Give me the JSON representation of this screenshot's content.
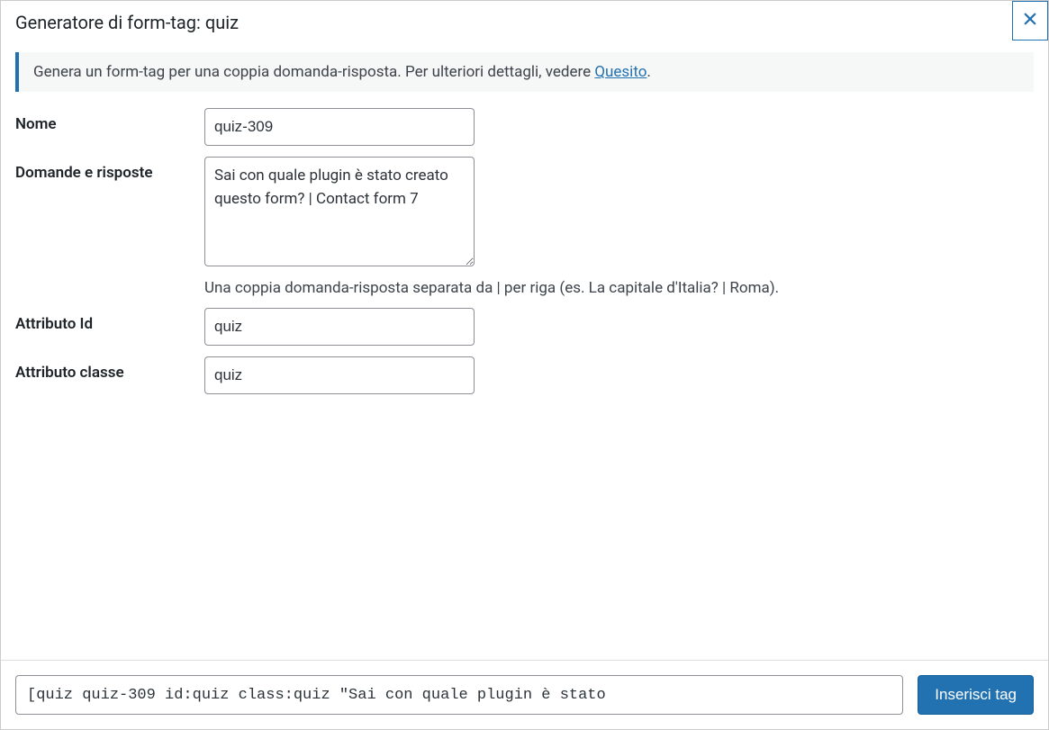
{
  "header": {
    "title": "Generatore di form-tag: quiz"
  },
  "notice": {
    "text_before": "Genera un form-tag per una coppia domanda-risposta. Per ulteriori dettagli, vedere ",
    "link_text": "Quesito",
    "text_after": "."
  },
  "fields": {
    "name": {
      "label": "Nome",
      "value": "quiz-309"
    },
    "qa": {
      "label": "Domande e risposte",
      "value": "Sai con quale plugin è stato creato questo form? | Contact form 7",
      "hint": "Una coppia domanda-risposta separata da | per riga (es. La capitale d'Italia? | Roma)."
    },
    "id": {
      "label": "Attributo Id",
      "value": "quiz"
    },
    "class": {
      "label": "Attributo classe",
      "value": "quiz"
    }
  },
  "footer": {
    "tag": "[quiz quiz-309 id:quiz class:quiz \"Sai con quale plugin è stato",
    "insert_label": "Inserisci tag"
  }
}
